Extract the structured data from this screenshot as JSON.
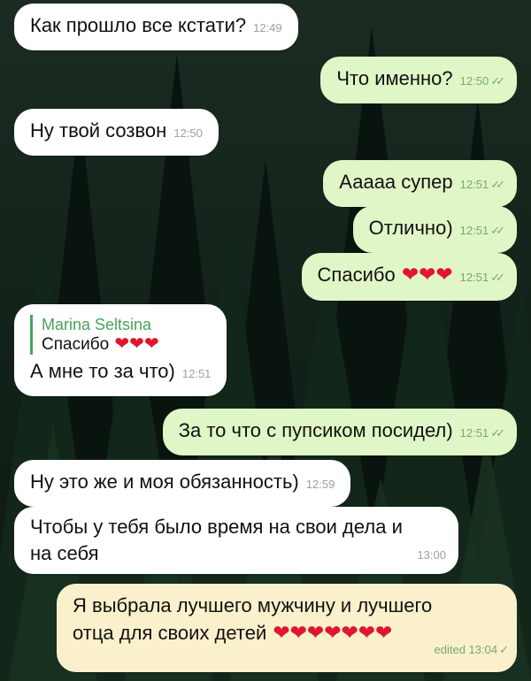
{
  "messages": [
    {
      "text": "Как прошло все кстати?",
      "time": "12:49"
    },
    {
      "text": "Что именно?",
      "time": "12:50",
      "check": "✓✓"
    },
    {
      "text": "Ну твой созвон",
      "time": "12:50"
    },
    {
      "text": "Ааааа супер",
      "time": "12:51",
      "check": "✓✓"
    },
    {
      "text": "Отлично)",
      "time": "12:51",
      "check": "✓✓"
    },
    {
      "text": "Спасибо",
      "hearts": "❤❤❤",
      "time": "12:51",
      "check": "✓✓"
    },
    {
      "reply_name": "Marina Seltsina",
      "reply_text": "Спасибо",
      "reply_hearts": "❤❤❤",
      "text": "А мне то за что)",
      "time": "12:51"
    },
    {
      "text": "За то что с пупсиком посидел)",
      "time": "12:51",
      "check": "✓✓"
    },
    {
      "text": "Ну это же и моя обязанность)",
      "time": "12:59"
    },
    {
      "line1": "Чтобы у тебя было время на свои дела и",
      "line2": "на себя",
      "time": "13:00"
    },
    {
      "line1": "Я выбрала лучшего мужчину и лучшего",
      "line2": "отца для своих детей",
      "hearts": "❤❤❤❤❤❤❤",
      "time": "edited 13:04",
      "check": "✓"
    }
  ],
  "colors": {
    "incoming": "#ffffff",
    "outgoing": "#e1f6c7",
    "edited_outgoing": "#faf0cc",
    "accent": "#48a35a",
    "heart": "#e0162b"
  },
  "background": "dark pine forest"
}
